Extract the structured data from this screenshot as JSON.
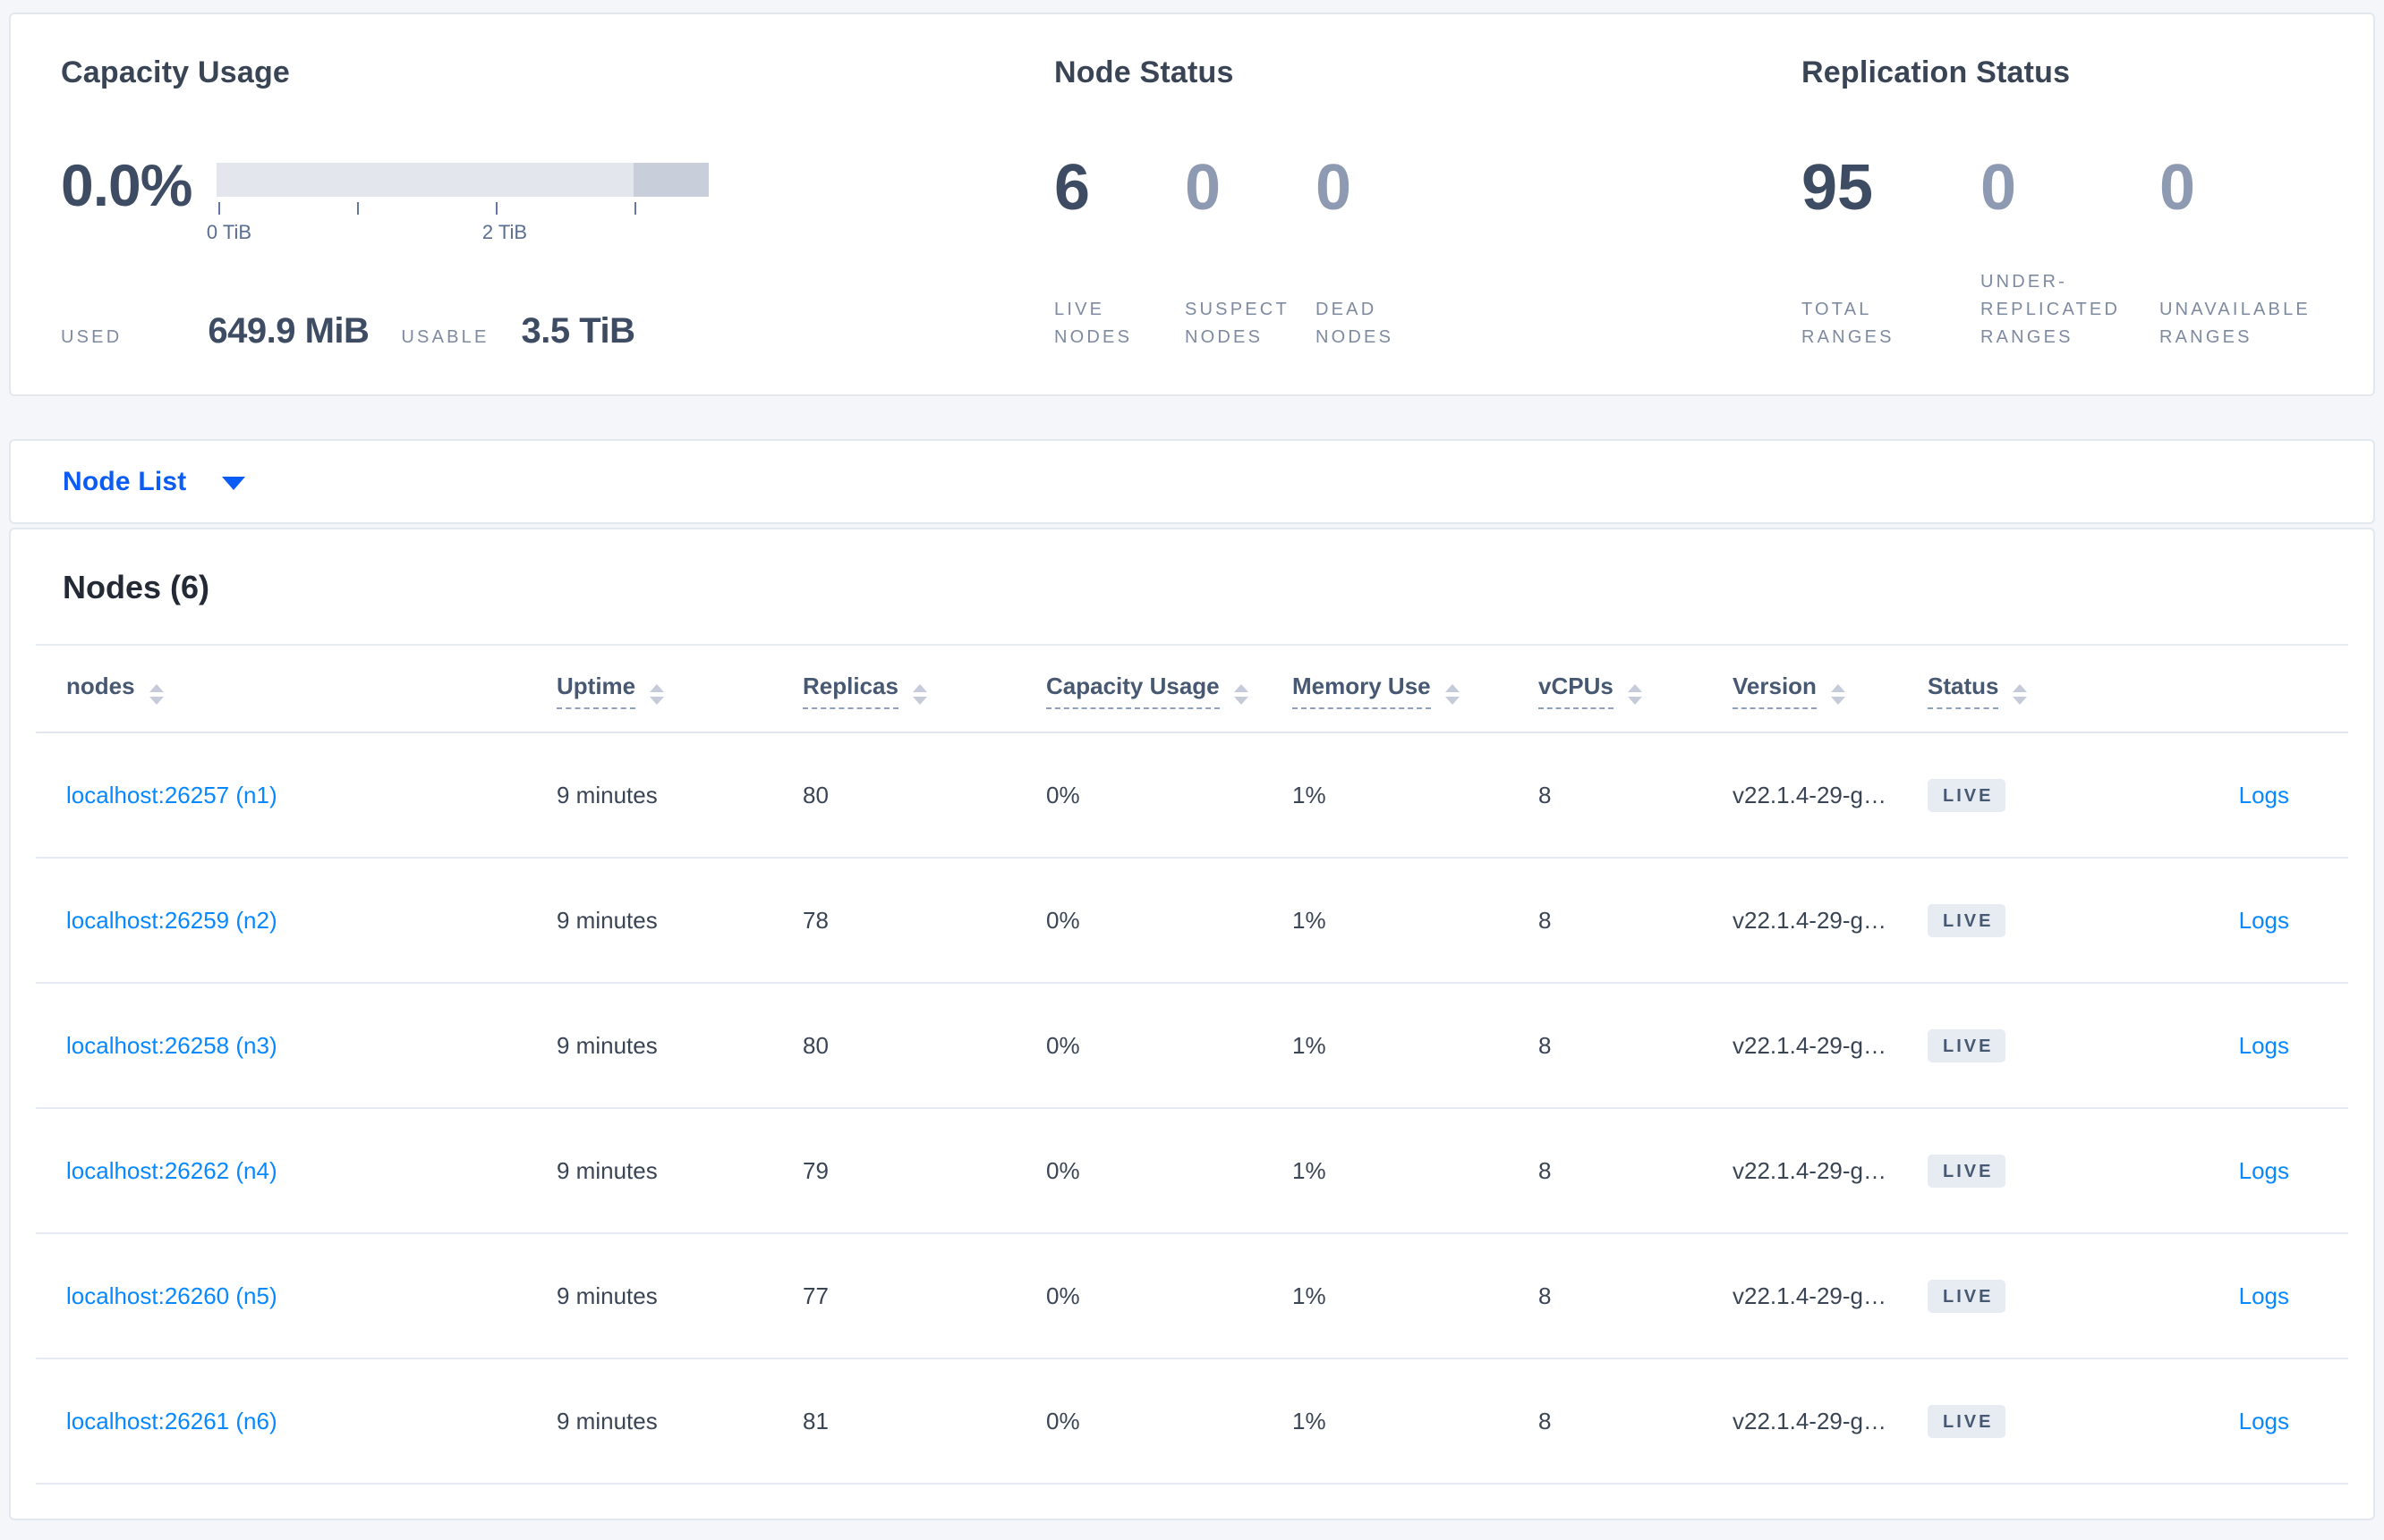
{
  "colors": {
    "page_background": "#f4f6fa",
    "card_border": "#e3e8ef",
    "link_blue": "#0788ff",
    "selector_blue": "#0b5cf5",
    "stat_dark": "#3e4c63",
    "stat_light": "#8e99b2",
    "label_gray": "#7e8aa0",
    "bar_light": "#e3e6ed",
    "bar_dark": "#c9cedb",
    "badge_background": "#e7ebf2",
    "badge_text": "#475872"
  },
  "summary": {
    "capacity": {
      "title": "Capacity Usage",
      "percent": "0.0%",
      "used_label": "USED",
      "used_value": "649.9 MiB",
      "usable_label": "USABLE",
      "usable_value": "3.5 TiB",
      "chart_data": {
        "type": "bar",
        "title": "Capacity Usage",
        "used_fraction": 0.0,
        "axis_min_tib": 0,
        "axis_max_tib": 3.5,
        "tick_interval_tib": 1,
        "tick_labels": [
          "0 TiB",
          "2 TiB"
        ],
        "highlight_segment_fraction": [
          0.85,
          1.0
        ]
      }
    },
    "node_status": {
      "title": "Node Status",
      "stats": [
        {
          "value": "6",
          "label": "LIVE NODES"
        },
        {
          "value": "0",
          "label": "SUSPECT NODES"
        },
        {
          "value": "0",
          "label": "DEAD NODES"
        }
      ]
    },
    "replication": {
      "title": "Replication Status",
      "stats": [
        {
          "value": "95",
          "label": "TOTAL RANGES"
        },
        {
          "value": "0",
          "label": "UNDER-REPLICATED RANGES"
        },
        {
          "value": "0",
          "label": "UNAVAILABLE RANGES"
        }
      ]
    }
  },
  "view_selector": {
    "label": "Node List"
  },
  "nodes_table": {
    "title": "Nodes (6)",
    "columns": [
      {
        "label": "nodes"
      },
      {
        "label": "Uptime"
      },
      {
        "label": "Replicas"
      },
      {
        "label": "Capacity Usage"
      },
      {
        "label": "Memory Use"
      },
      {
        "label": "vCPUs"
      },
      {
        "label": "Version"
      },
      {
        "label": "Status"
      }
    ],
    "rows": [
      {
        "address": "localhost:26257 (n1)",
        "uptime": "9 minutes",
        "replicas": "80",
        "capacity": "0%",
        "memory": "1%",
        "vcpus": "8",
        "version": "v22.1.4-29-g…",
        "status": "LIVE",
        "logs": "Logs"
      },
      {
        "address": "localhost:26259 (n2)",
        "uptime": "9 minutes",
        "replicas": "78",
        "capacity": "0%",
        "memory": "1%",
        "vcpus": "8",
        "version": "v22.1.4-29-g…",
        "status": "LIVE",
        "logs": "Logs"
      },
      {
        "address": "localhost:26258 (n3)",
        "uptime": "9 minutes",
        "replicas": "80",
        "capacity": "0%",
        "memory": "1%",
        "vcpus": "8",
        "version": "v22.1.4-29-g…",
        "status": "LIVE",
        "logs": "Logs"
      },
      {
        "address": "localhost:26262 (n4)",
        "uptime": "9 minutes",
        "replicas": "79",
        "capacity": "0%",
        "memory": "1%",
        "vcpus": "8",
        "version": "v22.1.4-29-g…",
        "status": "LIVE",
        "logs": "Logs"
      },
      {
        "address": "localhost:26260 (n5)",
        "uptime": "9 minutes",
        "replicas": "77",
        "capacity": "0%",
        "memory": "1%",
        "vcpus": "8",
        "version": "v22.1.4-29-g…",
        "status": "LIVE",
        "logs": "Logs"
      },
      {
        "address": "localhost:26261 (n6)",
        "uptime": "9 minutes",
        "replicas": "81",
        "capacity": "0%",
        "memory": "1%",
        "vcpus": "8",
        "version": "v22.1.4-29-g…",
        "status": "LIVE",
        "logs": "Logs"
      }
    ]
  }
}
